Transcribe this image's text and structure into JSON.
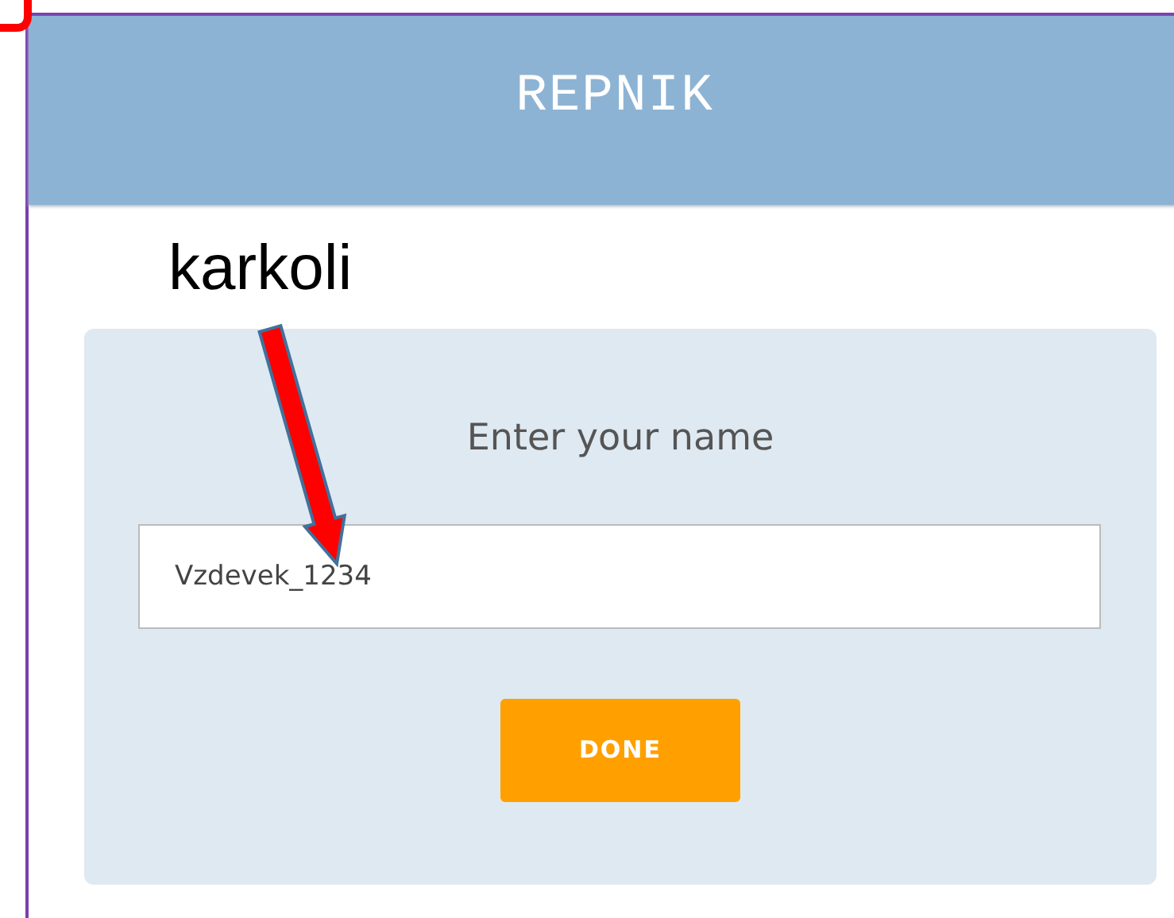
{
  "header": {
    "title": "REPNIK"
  },
  "annotation": {
    "label": "karkoli"
  },
  "form": {
    "prompt": "Enter your name",
    "name_field": {
      "value": "Vzdevek_1234"
    },
    "button": "DONE"
  }
}
